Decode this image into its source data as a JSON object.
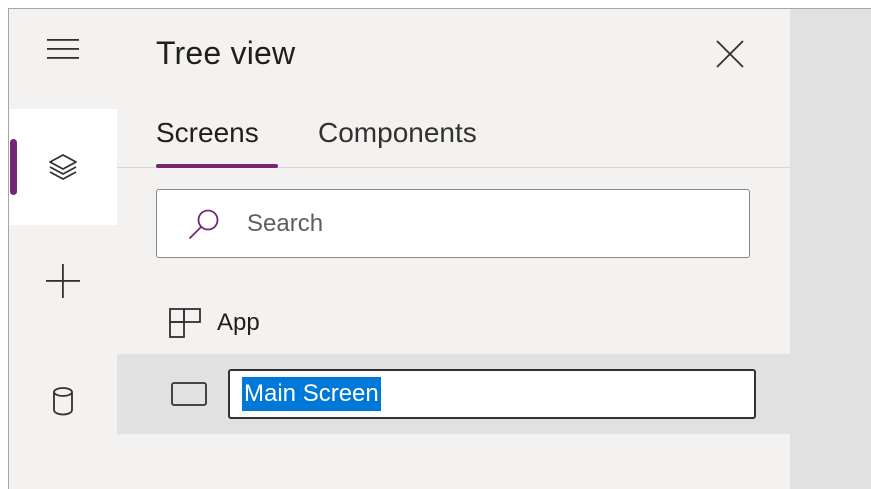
{
  "panel": {
    "title": "Tree view",
    "close_icon": "close-icon"
  },
  "rail": {
    "items": [
      {
        "name": "menu",
        "icon": "hamburger-icon",
        "active": false
      },
      {
        "name": "tree-view",
        "icon": "layers-icon",
        "active": true
      },
      {
        "name": "insert",
        "icon": "plus-icon",
        "active": false
      },
      {
        "name": "data",
        "icon": "database-icon",
        "active": false
      }
    ],
    "accent": "#742774"
  },
  "tabs": [
    {
      "label": "Screens",
      "selected": true
    },
    {
      "label": "Components",
      "selected": false
    }
  ],
  "search": {
    "placeholder": "Search",
    "icon": "search-icon"
  },
  "tree": {
    "app_label": "App",
    "screen_rename_value": "Main Screen"
  },
  "colors": {
    "accent": "#742774",
    "selection": "#0078d7"
  }
}
